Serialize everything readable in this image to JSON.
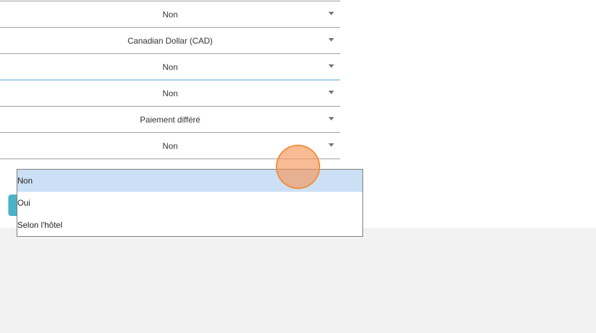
{
  "form": {
    "rows": [
      {
        "value": "Non"
      },
      {
        "value": "Canadian Dollar (CAD)"
      },
      {
        "value": "Non"
      },
      {
        "value": "Non"
      },
      {
        "value": "Paiement différé"
      },
      {
        "value": "Non"
      }
    ]
  },
  "dropdown": {
    "options": [
      {
        "label": "Non",
        "selected": true
      },
      {
        "label": "Oui",
        "selected": false
      },
      {
        "label": "Selon l'hôtel",
        "selected": false
      }
    ]
  },
  "colors": {
    "selected_option_bg": "#cbe0f5",
    "focus_underline": "#5aa9d6",
    "accent_button": "#4ab3c7",
    "touch_indicator": "#f0903c"
  }
}
